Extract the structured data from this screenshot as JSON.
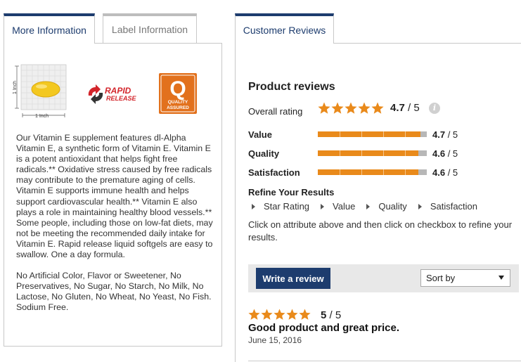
{
  "left_tabs": {
    "more_info": "More Information",
    "label_info": "Label Information"
  },
  "icons": {
    "size_graphic": {
      "vertical_label": "1 Inch",
      "horizontal_label": "1 Inch"
    },
    "rapid_release": {
      "line1": "RAPID",
      "line2": "RELEASE"
    },
    "quality_assured": {
      "letter": "Q",
      "line1": "QUALITY",
      "line2": "ASSURED"
    }
  },
  "description": {
    "paragraph1": "Our Vitamin E supplement features dl-Alpha Vitamin E, a synthetic form of Vitamin E. Vitamin E is a potent antioxidant that helps fight free radicals.** Oxidative stress caused by free radicals may contribute to the premature aging of cells. Vitamin E supports immune health and helps support cardiovascular health.** Vitamin E also plays a role in maintaining healthy blood vessels.** Some people, including those on low-fat diets, may not be meeting the recommended daily intake for Vitamin E. Rapid release liquid softgels are easy to swallow. One a day formula.",
    "paragraph2": "No Artificial Color, Flavor or Sweetener, No Preservatives, No Sugar, No Starch, No Milk, No Lactose, No Gluten, No Wheat, No Yeast, No Fish. Sodium Free."
  },
  "right_tab": {
    "customer_reviews": "Customer Reviews"
  },
  "reviews": {
    "heading": "Product reviews",
    "overall_label": "Overall rating",
    "overall_score": "4.7",
    "overall_of": "/ 5",
    "overall_rating": 4.7,
    "attributes": [
      {
        "name": "Value",
        "score": "4.7",
        "of": "/ 5",
        "rating": 4.7
      },
      {
        "name": "Quality",
        "score": "4.6",
        "of": "/ 5",
        "rating": 4.6
      },
      {
        "name": "Satisfaction",
        "score": "4.6",
        "of": "/ 5",
        "rating": 4.6
      }
    ],
    "refine_title": "Refine Your Results",
    "refine_links": [
      "Star Rating",
      "Value",
      "Quality",
      "Satisfaction"
    ],
    "refine_note": "Click on attribute above and then click on checkbox to refine your results.",
    "write_review": "Write a review",
    "sort_by": "Sort by",
    "first_review": {
      "score": "5",
      "of": "/ 5",
      "rating": 5,
      "title": "Good product and great price.",
      "date": "June 15, 2016"
    }
  },
  "colors": {
    "navy": "#1d3c6e",
    "star_orange": "#e98a1b",
    "bar_gray": "#b7b7b7",
    "quality_orange": "#e2711d",
    "rapid_red": "#d3252b"
  }
}
